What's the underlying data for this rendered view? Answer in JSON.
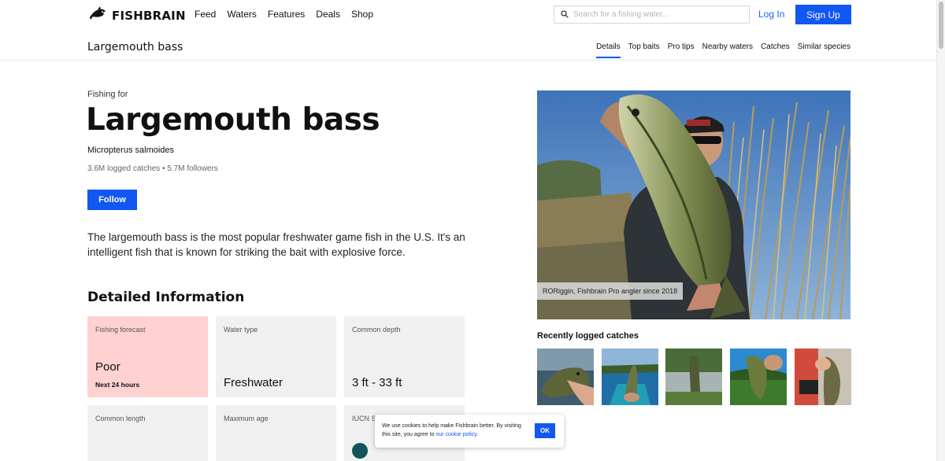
{
  "header": {
    "logo_text": "FISHBRAIN",
    "logo_icon": "fish-icon",
    "nav": [
      "Feed",
      "Waters",
      "Features",
      "Deals",
      "Shop"
    ],
    "search_placeholder": "Search for a fishing water...",
    "login_label": "Log In",
    "signup_label": "Sign Up",
    "accent_color": "#1157f2"
  },
  "subnav": {
    "title": "Largemouth bass",
    "tabs": [
      "Details",
      "Top baits",
      "Pro tips",
      "Nearby waters",
      "Catches",
      "Similar species"
    ],
    "active_tab": "Details"
  },
  "species": {
    "kicker": "Fishing for",
    "name": "Largemouth bass",
    "scientific_name": "Micropterus salmoides",
    "stats": "3.6M logged catches • 5.7M followers",
    "follow_label": "Follow",
    "description": "The largemouth bass is the most popular freshwater game fish in the U.S. It's an intelligent fish that is known for striking the bait with explosive force."
  },
  "details": {
    "section_title": "Detailed Information",
    "cards": [
      {
        "label": "Fishing forecast",
        "value": "Poor",
        "sub": "Next 24 hours",
        "color": "#ffd1d1"
      },
      {
        "label": "Water type",
        "value": "Freshwater"
      },
      {
        "label": "Common depth",
        "value": "3 ft - 33 ft"
      },
      {
        "label": "Common length",
        "value": ""
      },
      {
        "label": "Maximum age",
        "value": ""
      },
      {
        "label": "IUCN St",
        "value": "",
        "status_color": "#11545a"
      }
    ]
  },
  "photo": {
    "credit": "RORiggin, Fishbrain Pro angler since 2018"
  },
  "recent": {
    "title": "Recently logged catches",
    "thumb_count": 5
  },
  "cookie": {
    "text_before": "We use cookies to help make Fishbrain better. By visiting this site, you agree to ",
    "link_text": "our cookie policy",
    "text_after": ".",
    "ok_label": "OK"
  }
}
